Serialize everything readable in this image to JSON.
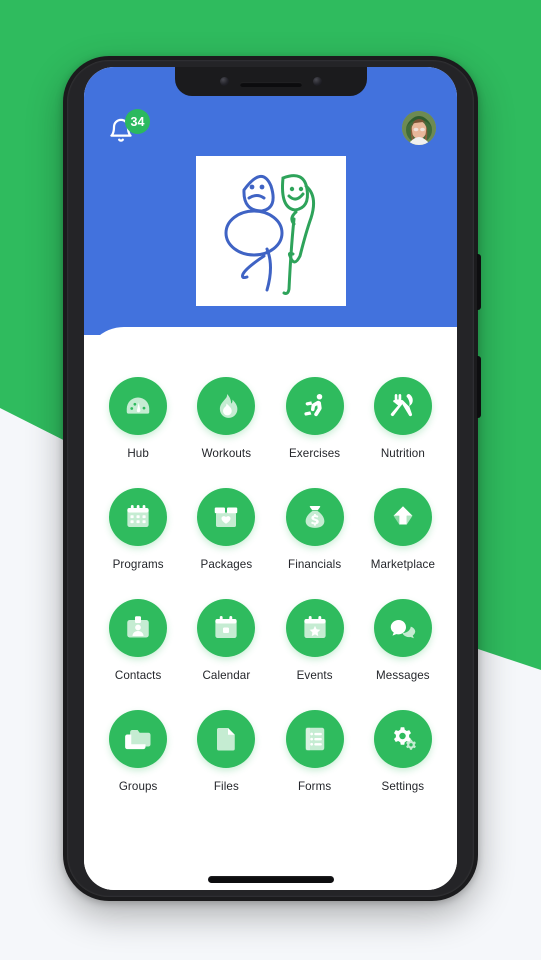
{
  "colors": {
    "page_background": "#f5f7fa",
    "accent_green": "#2fbb5e",
    "header_blue": "#4272dd",
    "badge_green": "#2bb95f",
    "phone_frame": "#1b1b1d",
    "label_text": "#24262b",
    "logo_blue": "#3f63c4",
    "logo_green": "#2ea35a"
  },
  "header": {
    "notifications": {
      "icon": "bell-icon",
      "badge_count": "34"
    },
    "avatar": {
      "icon": "avatar",
      "alt": "user profile photo"
    },
    "logo": {
      "icon": "app-logo",
      "alt": "hand drawn blue sad figure and green happy figure"
    }
  },
  "grid": {
    "items": [
      {
        "label": "Hub",
        "icon": "gauge-icon"
      },
      {
        "label": "Workouts",
        "icon": "flame-icon"
      },
      {
        "label": "Exercises",
        "icon": "running-person-icon"
      },
      {
        "label": "Nutrition",
        "icon": "fork-knife-icon"
      },
      {
        "label": "Programs",
        "icon": "calendar-grid-icon"
      },
      {
        "label": "Packages",
        "icon": "box-heart-icon"
      },
      {
        "label": "Financials",
        "icon": "money-bag-icon"
      },
      {
        "label": "Marketplace",
        "icon": "send-arrow-icon"
      },
      {
        "label": "Contacts",
        "icon": "id-badge-icon"
      },
      {
        "label": "Calendar",
        "icon": "calendar-icon"
      },
      {
        "label": "Events",
        "icon": "calendar-star-icon"
      },
      {
        "label": "Messages",
        "icon": "chat-bubbles-icon"
      },
      {
        "label": "Groups",
        "icon": "folders-icon"
      },
      {
        "label": "Files",
        "icon": "document-icon"
      },
      {
        "label": "Forms",
        "icon": "checklist-icon"
      },
      {
        "label": "Settings",
        "icon": "gears-icon"
      }
    ]
  },
  "device": {
    "notch": "camera-notch",
    "speaker": "bottom-speaker-grill",
    "buttons": [
      "power-button",
      "volume-button"
    ]
  }
}
